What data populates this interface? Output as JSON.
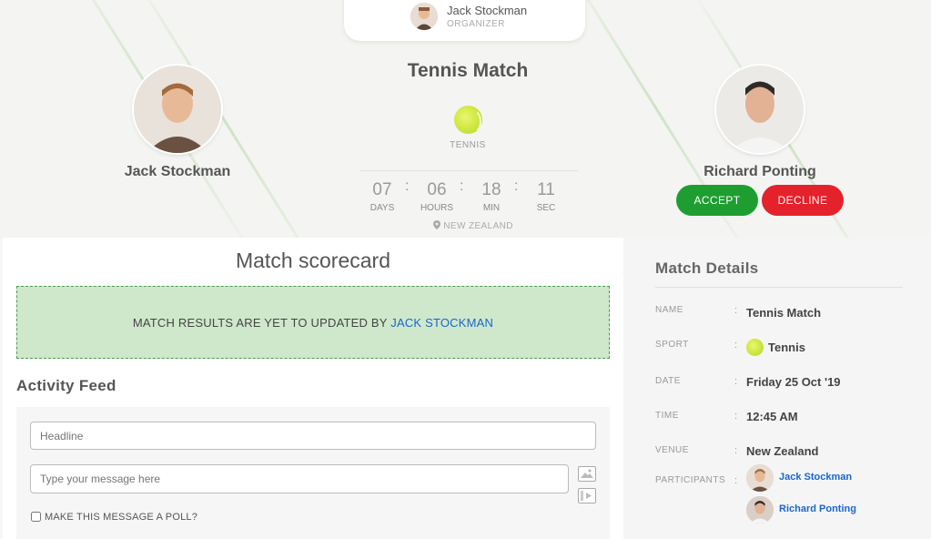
{
  "organizer": {
    "name": "Jack Stockman",
    "role": "ORGANIZER"
  },
  "match": {
    "title": "Tennis Match",
    "sport_label": "TENNIS",
    "location": "NEW ZEALAND"
  },
  "players": {
    "left": {
      "name": "Jack Stockman"
    },
    "right": {
      "name": "Richard Ponting"
    }
  },
  "countdown": [
    {
      "value": "07",
      "label": "DAYS"
    },
    {
      "value": "06",
      "label": "HOURS"
    },
    {
      "value": "18",
      "label": "MIN"
    },
    {
      "value": "11",
      "label": "SEC"
    }
  ],
  "separator": ":",
  "actions": {
    "accept": "ACCEPT",
    "decline": "DECLINE"
  },
  "scorecard": {
    "title": "Match scorecard",
    "message_prefix": "MATCH RESULTS ARE YET TO UPDATED BY",
    "message_link": "JACK STOCKMAN"
  },
  "feed": {
    "title": "Activity Feed",
    "headline_placeholder": "Headline",
    "message_placeholder": "Type your message here",
    "poll_label": "MAKE THIS MESSAGE A POLL?"
  },
  "details": {
    "title": "Match Details",
    "rows": [
      {
        "key": "NAME",
        "value": "Tennis Match"
      },
      {
        "key": "SPORT",
        "value": "Tennis"
      },
      {
        "key": "DATE",
        "value": "Friday 25 Oct '19"
      },
      {
        "key": "TIME",
        "value": "12:45 AM"
      },
      {
        "key": "VENUE",
        "value": "New Zealand"
      },
      {
        "key": "PARTICIPANTS",
        "value": ""
      }
    ],
    "participants": [
      "Jack Stockman",
      "Richard Ponting"
    ]
  },
  "icons": {
    "sport": "tennis-ball-icon",
    "location": "map-pin-icon",
    "image_upload": "image-upload-icon",
    "video_upload": "video-upload-icon"
  },
  "colors": {
    "accept": "#1e9e30",
    "decline": "#e4222c",
    "link": "#1b66c9",
    "notice_bg": "#cfe8cc"
  }
}
